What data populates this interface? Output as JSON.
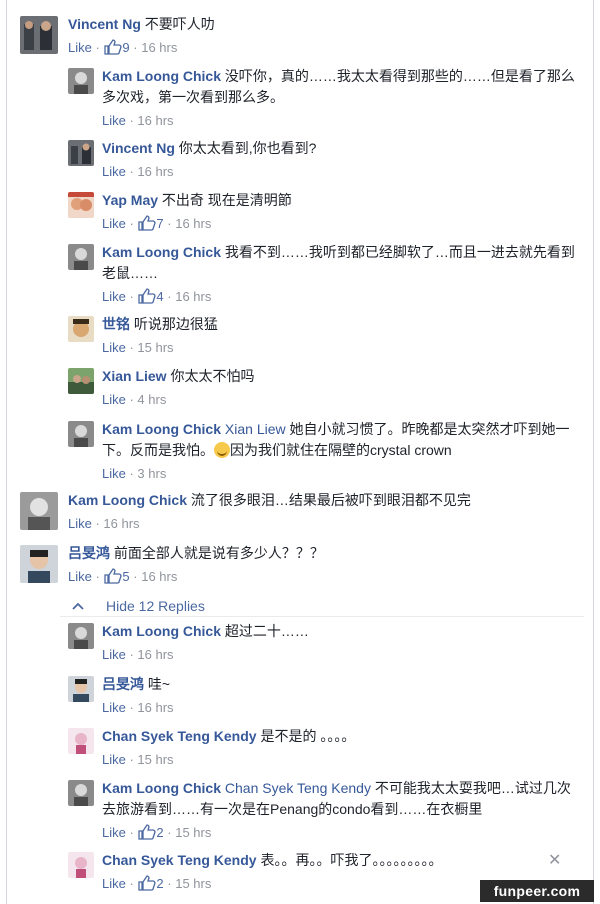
{
  "thumb_glyph": "👍",
  "comments": [
    {
      "name": "Vincent Ng",
      "text": "不要吓人叻",
      "like": "Like",
      "likes": "9",
      "time": "16 hrs"
    },
    {
      "name": "Kam Loong Chick",
      "text": "没吓你，真的……我太太看得到那些的……但是看了那么多次戏，第一次看到那么多。",
      "like": "Like",
      "likes": "",
      "time": "16 hrs"
    },
    {
      "name": "Vincent Ng",
      "text": "你太太看到,你也看到?",
      "like": "Like",
      "likes": "",
      "time": "16 hrs"
    },
    {
      "name": "Yap May",
      "text": "不出奇 现在是清明節",
      "like": "Like",
      "likes": "7",
      "time": "16 hrs"
    },
    {
      "name": "Kam Loong Chick",
      "text": "我看不到……我听到都已经脚软了…而且一进去就先看到老鼠……",
      "like": "Like",
      "likes": "4",
      "time": "16 hrs"
    },
    {
      "name": "世铭",
      "text": "听说那边很猛",
      "like": "Like",
      "likes": "",
      "time": "15 hrs"
    },
    {
      "name": "Xian Liew",
      "text": "你太太不怕吗",
      "like": "Like",
      "likes": "",
      "time": "4 hrs"
    },
    {
      "name": "Kam Loong Chick",
      "tag": "Xian Liew",
      "text": "她自小就习惯了。昨晚都是太突然才吓到她一下。反而是我怕。",
      "text2": "因为我们就住在隔壁的crystal crown",
      "like": "Like",
      "likes": "",
      "time": "3 hrs"
    },
    {
      "name": "Kam Loong Chick",
      "text": "流了很多眼泪…结果最后被吓到眼泪都不见完",
      "like": "Like",
      "likes": "",
      "time": "16 hrs"
    },
    {
      "name": "吕旻鸿",
      "text": "前面全部人就是说有多少人？？？",
      "like": "Like",
      "likes": "5",
      "time": "16 hrs"
    },
    {
      "name": "Kam Loong Chick",
      "text": "超过二十……",
      "like": "Like",
      "likes": "",
      "time": "16 hrs"
    },
    {
      "name": "吕旻鸿",
      "text": "哇~",
      "like": "Like",
      "likes": "",
      "time": "16 hrs"
    },
    {
      "name": "Chan Syek Teng Kendy",
      "text": "是不是的 。。。。",
      "like": "Like",
      "likes": "",
      "time": "15 hrs"
    },
    {
      "name": "Kam Loong Chick",
      "tag": "Chan Syek Teng Kendy",
      "text": "不可能我太太耍我吧…试过几次去旅游看到……有一次是在Penang的condo看到……在衣橱里",
      "like": "Like",
      "likes": "2",
      "time": "15 hrs"
    },
    {
      "name": "Chan Syek Teng Kendy",
      "text": "表。。再。。吓我了。。。。。。。。。",
      "like": "Like",
      "likes": "2",
      "time": "15 hrs"
    }
  ],
  "hide_replies": "Hide 12 Replies",
  "hide_icon": "chevron-up",
  "close_glyph": "✕",
  "watermark": "funpeer.com",
  "colors": {
    "link": "#365899",
    "meta": "#90949c",
    "action": "#4b68a0"
  }
}
